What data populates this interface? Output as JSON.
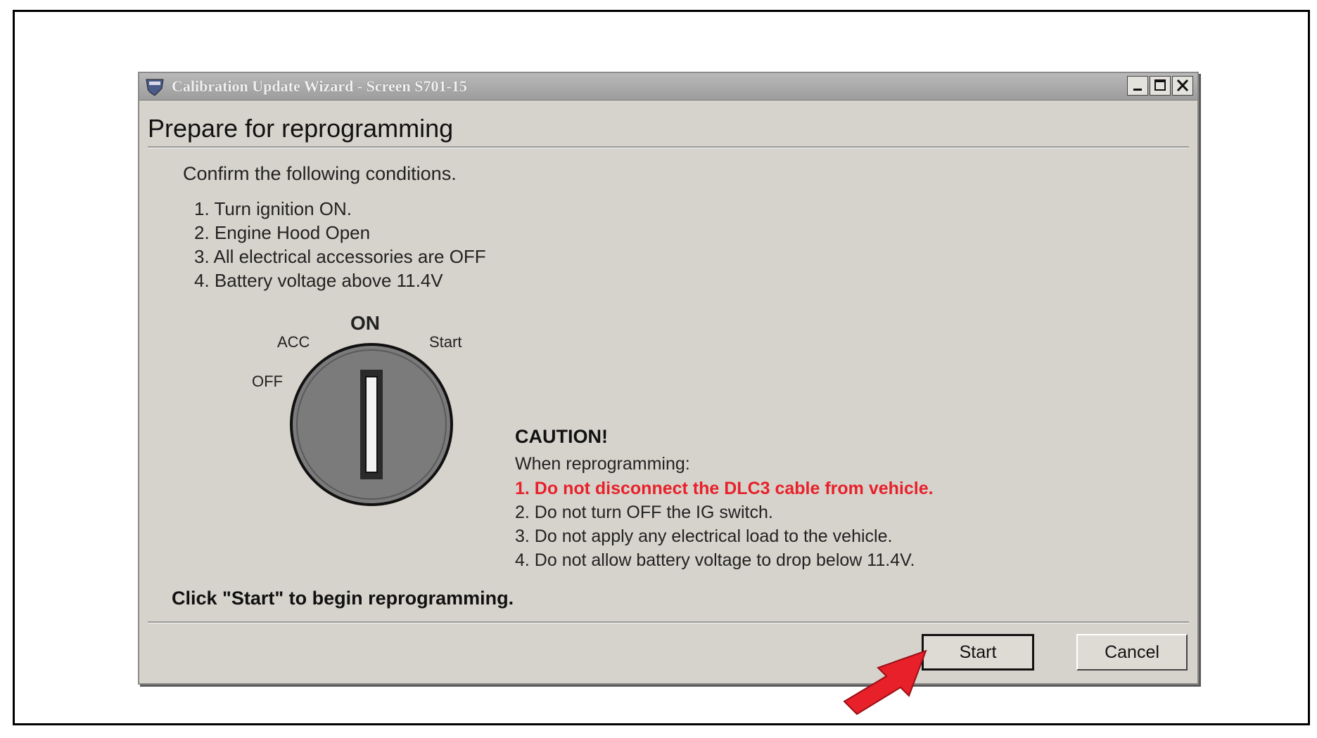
{
  "window": {
    "title": "Calibration Update Wizard - Screen S701-15",
    "heading": "Prepare for reprogramming"
  },
  "conditions": {
    "intro": "Confirm the following conditions.",
    "items": [
      "1. Turn ignition ON.",
      "2. Engine Hood Open",
      "3. All electrical accessories are OFF",
      "4. Battery voltage above 11.4V"
    ]
  },
  "ignition_key": {
    "labels": {
      "on": "ON",
      "acc": "ACC",
      "start": "Start",
      "off": "OFF"
    }
  },
  "caution": {
    "title": "CAUTION!",
    "subtitle": "When reprogramming:",
    "items": [
      "1. Do not disconnect the DLC3 cable from vehicle.",
      "2. Do not turn OFF the IG switch.",
      "3. Do not apply any electrical load to the vehicle.",
      "4. Do not allow battery voltage to drop below 11.4V."
    ]
  },
  "footer": {
    "instruction": "Click \"Start\" to begin reprogramming.",
    "start_label": "Start",
    "cancel_label": "Cancel"
  },
  "colors": {
    "window_bg": "#d6d3cc",
    "warning_text": "#e8202a",
    "arrow": "#e8202a"
  }
}
